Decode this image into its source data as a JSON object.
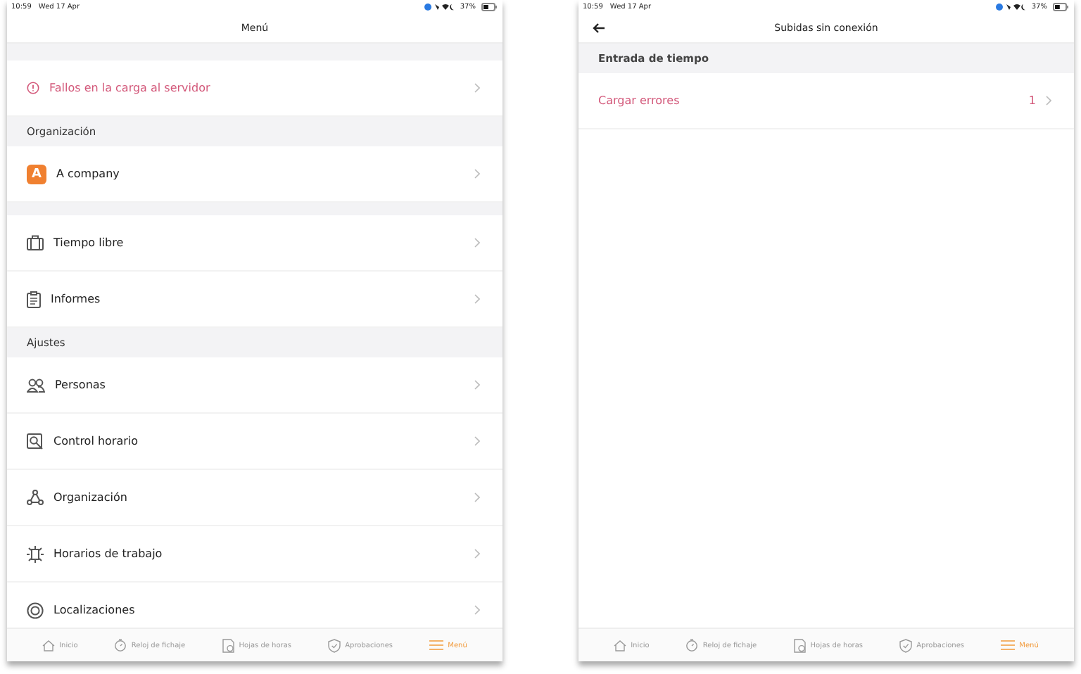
{
  "screens": [
    {
      "status_bar": {
        "time": "10:59",
        "date": "Wed 17 Apr",
        "battery": "37%"
      },
      "header": {
        "title": "Menú",
        "back": false
      },
      "items": [
        {
          "kind": "spacer"
        },
        {
          "kind": "row",
          "label": "Fallos en la carga al servidor",
          "alert": true
        },
        {
          "kind": "section",
          "label": "Organización",
          "bold": false
        },
        {
          "kind": "row",
          "label": "A company",
          "alert": false,
          "badge": "A"
        },
        {
          "kind": "spacer"
        },
        {
          "kind": "row",
          "label": "Tiempo libre",
          "alert": false
        },
        {
          "kind": "row",
          "label": "Informes",
          "alert": false
        },
        {
          "kind": "section",
          "label": "Ajustes",
          "bold": false
        },
        {
          "kind": "row",
          "label": "Personas",
          "alert": false
        },
        {
          "kind": "row",
          "label": "Control horario",
          "alert": false
        },
        {
          "kind": "row",
          "label": "Organización",
          "alert": false
        },
        {
          "kind": "row",
          "label": "Horarios de trabajo",
          "alert": false
        },
        {
          "kind": "row",
          "label": "Localizaciones",
          "alert": false
        }
      ],
      "tabs": [
        {
          "label": "Inicio",
          "selected": false
        },
        {
          "label": "Reloj de fichaje",
          "selected": false
        },
        {
          "label": "Hojas de horas",
          "selected": false
        },
        {
          "label": "Aprobaciones",
          "selected": false
        },
        {
          "label": "Menú",
          "selected": true
        }
      ]
    },
    {
      "status_bar": {
        "time": "10:59",
        "date": "Wed 17 Apr",
        "battery": "37%"
      },
      "header": {
        "title": "Subidas sin conexión",
        "back": true
      },
      "items": [
        {
          "kind": "section",
          "label": "Entrada de tiempo",
          "bold": true
        },
        {
          "kind": "row",
          "label": "Cargar errores",
          "alert": true,
          "count": "1"
        }
      ],
      "tabs": [
        {
          "label": "Inicio",
          "selected": false
        },
        {
          "label": "Reloj de fichaje",
          "selected": false
        },
        {
          "label": "Hojas de horas",
          "selected": false
        },
        {
          "label": "Aprobaciones",
          "selected": false
        },
        {
          "label": "Menú",
          "selected": true
        }
      ]
    }
  ]
}
